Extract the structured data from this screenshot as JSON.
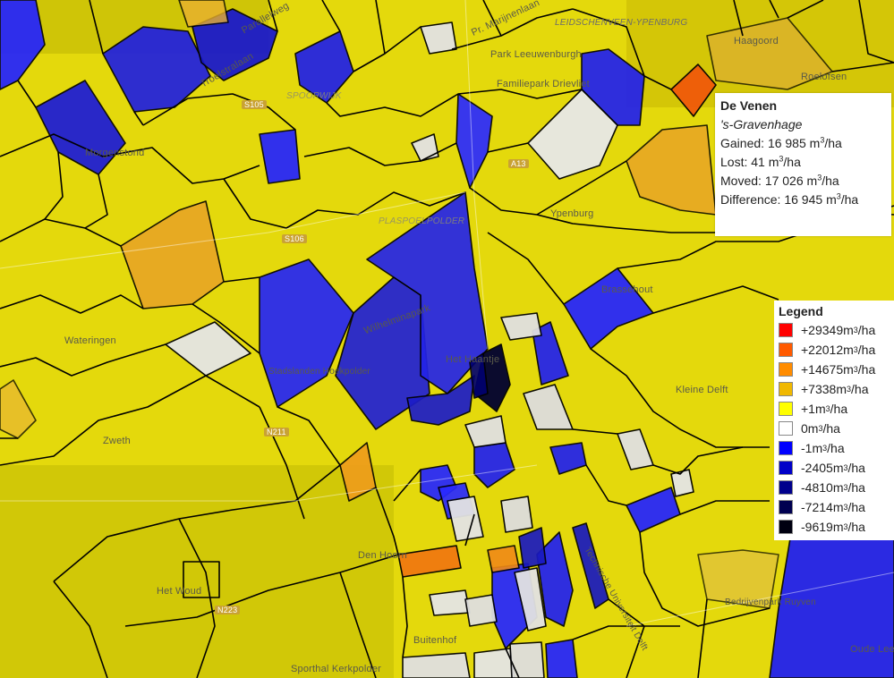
{
  "tooltip": {
    "name": "De Venen",
    "city": "'s-Gravenhage",
    "gained_label": "Gained:",
    "gained": "16 985",
    "lost_label": "Lost:",
    "lost": "41",
    "moved_label": "Moved:",
    "moved": "17 026",
    "difference_label": "Difference:",
    "difference": "16 945",
    "unit": "m",
    "unit_exp": "3",
    "unit_tail": "/ha"
  },
  "legend": {
    "title": "Legend",
    "items": [
      {
        "value": "+29349",
        "color": "#ff0000"
      },
      {
        "value": "+22012",
        "color": "#ff5a00"
      },
      {
        "value": "+14675",
        "color": "#ff8c00"
      },
      {
        "value": "+7338",
        "color": "#f0b800"
      },
      {
        "value": "+1",
        "color": "#ffff00"
      },
      {
        "value": "0",
        "color": "#ffffff"
      },
      {
        "value": "-1",
        "color": "#0000ff"
      },
      {
        "value": "-2405",
        "color": "#0000c8"
      },
      {
        "value": "-4810",
        "color": "#00008c"
      },
      {
        "value": "-7214",
        "color": "#000050"
      },
      {
        "value": "-9619",
        "color": "#000010"
      }
    ]
  },
  "map_labels": {
    "leidschenveen": "LEIDSCHENVEEN-YPENBURG",
    "haagoord": "Haagoord",
    "roelofsen": "Roelofsen",
    "pr_marijnen": "Pr. Marijnenlaan",
    "park_leeuwenburgh": "Park Leeuwenburgh",
    "familiepark": "Familiepark Drievliet",
    "parallelweg": "Parallelweg",
    "trekstraat": "Troelstralaan",
    "spoorwijk": "SPOORWIJK",
    "morgenstond": "Morgenstond",
    "plaspoelpolder": "PLASPOELPOLDER",
    "ypenburg": "Ypenburg",
    "brassehout": "Brassehout",
    "wateringen": "Wateringen",
    "wilhelminapark": "Wilhelminapark",
    "het_hainhof": "Het Haantje",
    "stadslanden": "Stadslanden Hoekpolder",
    "zweth": "Zweth",
    "kleine_delft": "Kleine Delft",
    "den_hoorn": "Den Hoorn",
    "het_woud": "Het Woud",
    "buitenhof": "Buitenhof",
    "sporthal": "Sporthal Kerkpolder",
    "tu_delft": "Technische Universiteit Delft",
    "oude_lee": "Oude Lee",
    "pijnacker": "Bedrijvenpark Ruyven",
    "n211": "N211",
    "n223": "N223",
    "a13": "A13",
    "s105": "S105",
    "s106": "S106"
  }
}
